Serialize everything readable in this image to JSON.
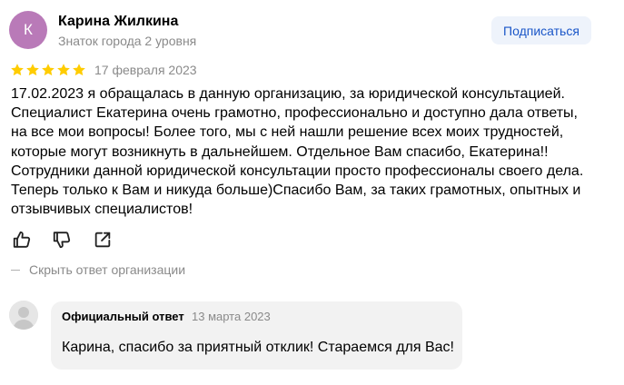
{
  "review": {
    "author": {
      "avatar_letter": "К",
      "avatar_color": "#b97ab8",
      "name": "Карина Жилкина",
      "level": "Знаток города 2 уровня"
    },
    "subscribe_label": "Подписаться",
    "rating": 5,
    "rating_max": 5,
    "star_color": "#fc0",
    "date": "17 февраля 2023",
    "text_lines": [
      "17.02.2023 я обращалась в данную организацию, за юридической консультацией.",
      "Специалист Екатерина очень грамотно, профессионально и доступно дала ответы,",
      "на все мои вопросы! Более того, мы с ней нашли решение всех моих трудностей,",
      "которые могут возникнуть в дальнейшем. Отдельное Вам спасибо, Екатерина!!",
      "Сотрудники данной юридической консультации просто профессионалы своего дела.",
      "Теперь только к Вам и никуда больше)Спасибо Вам, за таких грамотных, опытных и",
      "отзывчивых специалистов!"
    ],
    "actions": {
      "like_icon": "thumbs-up-icon",
      "dislike_icon": "thumbs-down-icon",
      "share_icon": "share-icon"
    },
    "hide_reply_label": "Скрыть ответ организации"
  },
  "reply": {
    "label": "Официальный ответ",
    "date": "13 марта 2023",
    "text": "Карина, спасибо за приятный отклик! Стараемся для Вас!"
  },
  "colors": {
    "accent": "#1a56c8",
    "subscribe_bg": "#eef3fb",
    "muted_text": "#8a8a8a",
    "reply_bg": "#f2f2f2"
  }
}
